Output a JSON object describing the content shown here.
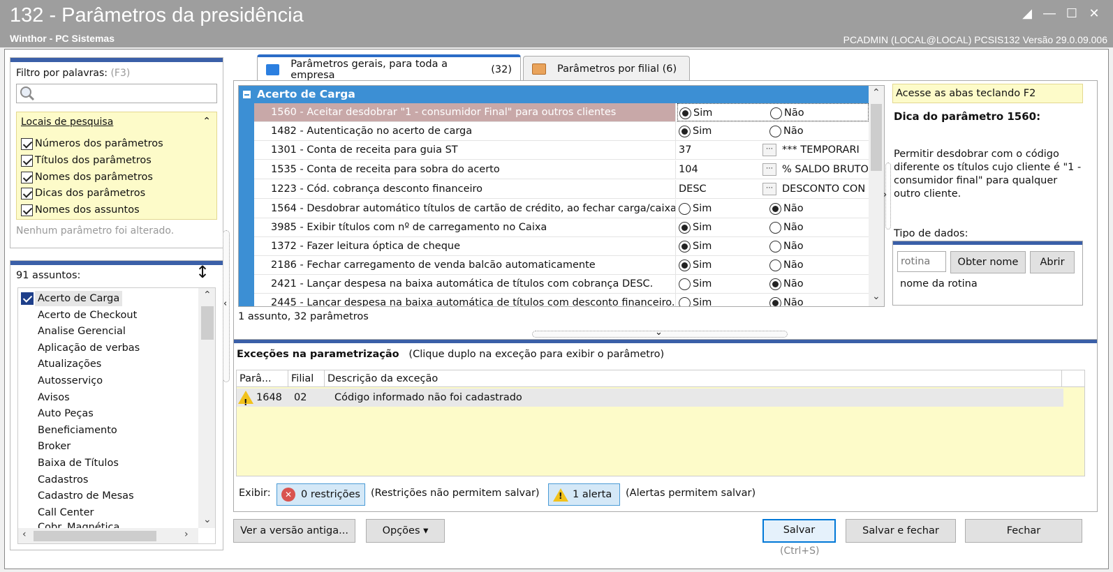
{
  "window": {
    "title": "132 - Parâmetros da presidência",
    "subtitle": "Winthor - PC Sistemas",
    "user_info": "PCADMIN (LOCAL@LOCAL)  PCSIS132  Versão  29.0.09.006"
  },
  "filter": {
    "label": "Filtro por palavras:",
    "shortcut": "(F3)",
    "search_value": "",
    "locations_title": "Locais de pesquisa",
    "locations": [
      {
        "label": "Números dos parâmetros",
        "checked": true
      },
      {
        "label": "Títulos dos parâmetros",
        "checked": true
      },
      {
        "label": "Nomes dos parâmetros",
        "checked": true
      },
      {
        "label": "Dicas dos parâmetros",
        "checked": true
      },
      {
        "label": "Nomes dos assuntos",
        "checked": true
      }
    ],
    "status": "Nenhum parâmetro foi alterado."
  },
  "subjects": {
    "count_label": "91 assuntos:",
    "items": [
      "Acerto de Carga",
      "Acerto de Checkout",
      "Analise Gerencial",
      "Aplicação de verbas",
      "Atualizações",
      "Autosserviço",
      "Avisos",
      "Auto Peças",
      "Beneficiamento",
      "Broker",
      "Baixa de Títulos",
      "Cadastros",
      "Cadastro de Mesas",
      "Call Center",
      "Cobr. Magnética"
    ],
    "selected": "Acerto de Carga"
  },
  "tabs": [
    {
      "label": "Parâmetros gerais, para toda a empresa",
      "count": "(32)",
      "active": true
    },
    {
      "label": "Parâmetros por filial",
      "count": "(6)",
      "active": false
    }
  ],
  "grid": {
    "group": "Acerto de Carga",
    "yes_label": "Sim",
    "no_label": "Não",
    "rows": [
      {
        "desc": "1560 - Aceitar desdobrar \"1 - consumidor Final\" para outros clientes",
        "type": "radio",
        "value": "Sim"
      },
      {
        "desc": "1482 - Autenticação no acerto de carga",
        "type": "radio",
        "value": "Sim"
      },
      {
        "desc": "1301 - Conta de receita para guia ST",
        "type": "lookup",
        "code": "37",
        "lookup": "*** TEMPORARI"
      },
      {
        "desc": "1535 - Conta de receita para sobra do acerto",
        "type": "lookup",
        "code": "104",
        "lookup": "% SALDO BRUTO"
      },
      {
        "desc": "1223 - Cód. cobrança desconto financeiro",
        "type": "lookup",
        "code": "DESC",
        "lookup": "DESCONTO CON"
      },
      {
        "desc": "1564 - Desdobrar automático títulos de cartão de crédito, ao fechar carga/caixa",
        "type": "radio",
        "value": "Não"
      },
      {
        "desc": "3985 - Exibir títulos com nº de carregamento no Caixa",
        "type": "radio",
        "value": "Sim"
      },
      {
        "desc": "1372 - Fazer leitura óptica de cheque",
        "type": "radio",
        "value": "Sim"
      },
      {
        "desc": "2186 - Fechar carregamento de venda balcão automaticamente",
        "type": "radio",
        "value": "Sim"
      },
      {
        "desc": "2421 - Lançar despesa na baixa automática de títulos com cobrança DESC.",
        "type": "radio",
        "value": "Não"
      },
      {
        "desc": "2445 - Lançar despesa na baixa automática de títulos com desconto financeiro.",
        "type": "radio",
        "value": "Não"
      }
    ],
    "footer": "1 assunto, 32 parâmetros"
  },
  "tip": {
    "banner": "Acesse as abas teclando F2",
    "title": "Dica do parâmetro 1560:",
    "text": "Permitir desdobrar com o código diferente os títulos cujo cliente é \"1 - consumidor final\" para qualquer outro cliente.",
    "data_type": "Tipo de dados:",
    "routine_placeholder": "rotina",
    "get_name_label": "Obter nome",
    "open_label": "Abrir",
    "routine_name": "nome da rotina"
  },
  "exceptions": {
    "title": "Exceções na parametrização",
    "hint": "(Clique duplo na exceção para exibir o parâmetro)",
    "columns": [
      "Parâ...",
      "Filial",
      "Descrição da exceção"
    ],
    "rows": [
      {
        "param": "1648",
        "branch": "02",
        "desc": "Código informado não foi cadastrado"
      }
    ],
    "show_label": "Exibir:",
    "restrictions_label": "0 restrições",
    "restrictions_note": "(Restrições não permitem salvar)",
    "alerts_label": "1 alerta",
    "alerts_note": "(Alertas permitem salvar)"
  },
  "buttons": {
    "old_version": "Ver a versão antiga...",
    "options": "Opções ▾",
    "save": "Salvar",
    "save_shortcut": "(Ctrl+S)",
    "save_close": "Salvar e fechar",
    "close": "Fechar"
  },
  "colors": {
    "accent": "#3c8fd4",
    "title_bar": "#9e9e9e",
    "highlight_yellow": "#fdfbc9",
    "selected_row": "#c8a8a8"
  }
}
